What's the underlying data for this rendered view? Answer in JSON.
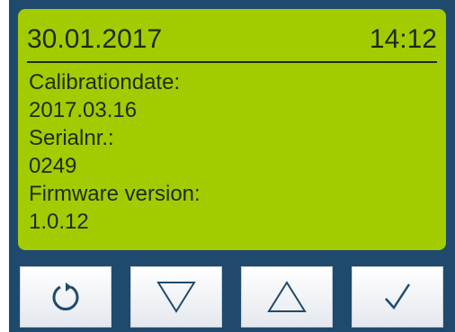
{
  "screen": {
    "date": "30.01.2017",
    "time": "14:12",
    "info": [
      "Calibrationdate:",
      "2017.03.16",
      "Serialnr.:",
      "0249",
      "Firmware version:",
      "1.0.12"
    ]
  },
  "buttons": [
    {
      "name": "refresh-button",
      "icon": "refresh-icon"
    },
    {
      "name": "down-button",
      "icon": "triangle-down-icon"
    },
    {
      "name": "up-button",
      "icon": "triangle-up-icon"
    },
    {
      "name": "confirm-button",
      "icon": "checkmark-icon"
    }
  ],
  "colors": {
    "frame": "#1f4a6e",
    "screen": "#a3cc00",
    "text": "#1f2a14",
    "button_icon": "#1f4a6e"
  }
}
